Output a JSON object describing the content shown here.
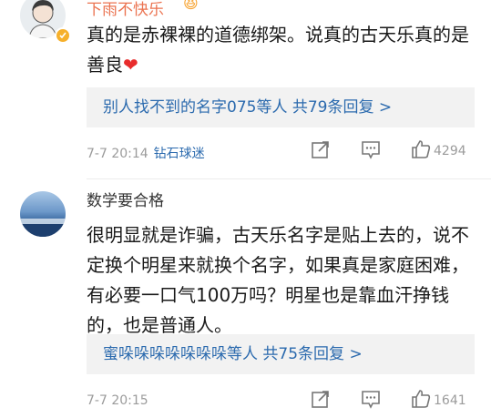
{
  "comments": [
    {
      "username": "下雨不快乐",
      "badge_emoji": "😆",
      "text": "真的是赤裸裸的道德绑架。说真的古天乐真的是善良",
      "heart": "❤",
      "reply_summary": "别人找不到的名字075等人 共79条回复 >",
      "date": "7-7 20:14",
      "fan_label": "钻石球迷",
      "likes": "4294"
    },
    {
      "username": "数学要合格",
      "text": "很明显就是诈骗，古天乐名字是贴上去的，说不定换个明星来就换个名字，如果真是家庭困难，有必要一口气100万吗？明星也是靠血汗挣钱的，也是普通人。",
      "reply_summary": "蜜哚哚哚哚哚哚哚等人 共75条回复 >",
      "date": "7-7 20:15",
      "likes": "1641"
    }
  ],
  "icons": {
    "share": "share-icon",
    "reply": "comment-icon",
    "like": "thumbs-up-icon",
    "verified": "verified-badge-icon"
  },
  "colors": {
    "username_highlight": "#eb7350",
    "link_blue": "#2b6aae",
    "meta_gray": "#9b9b9b",
    "heart_red": "#e82c2c"
  }
}
